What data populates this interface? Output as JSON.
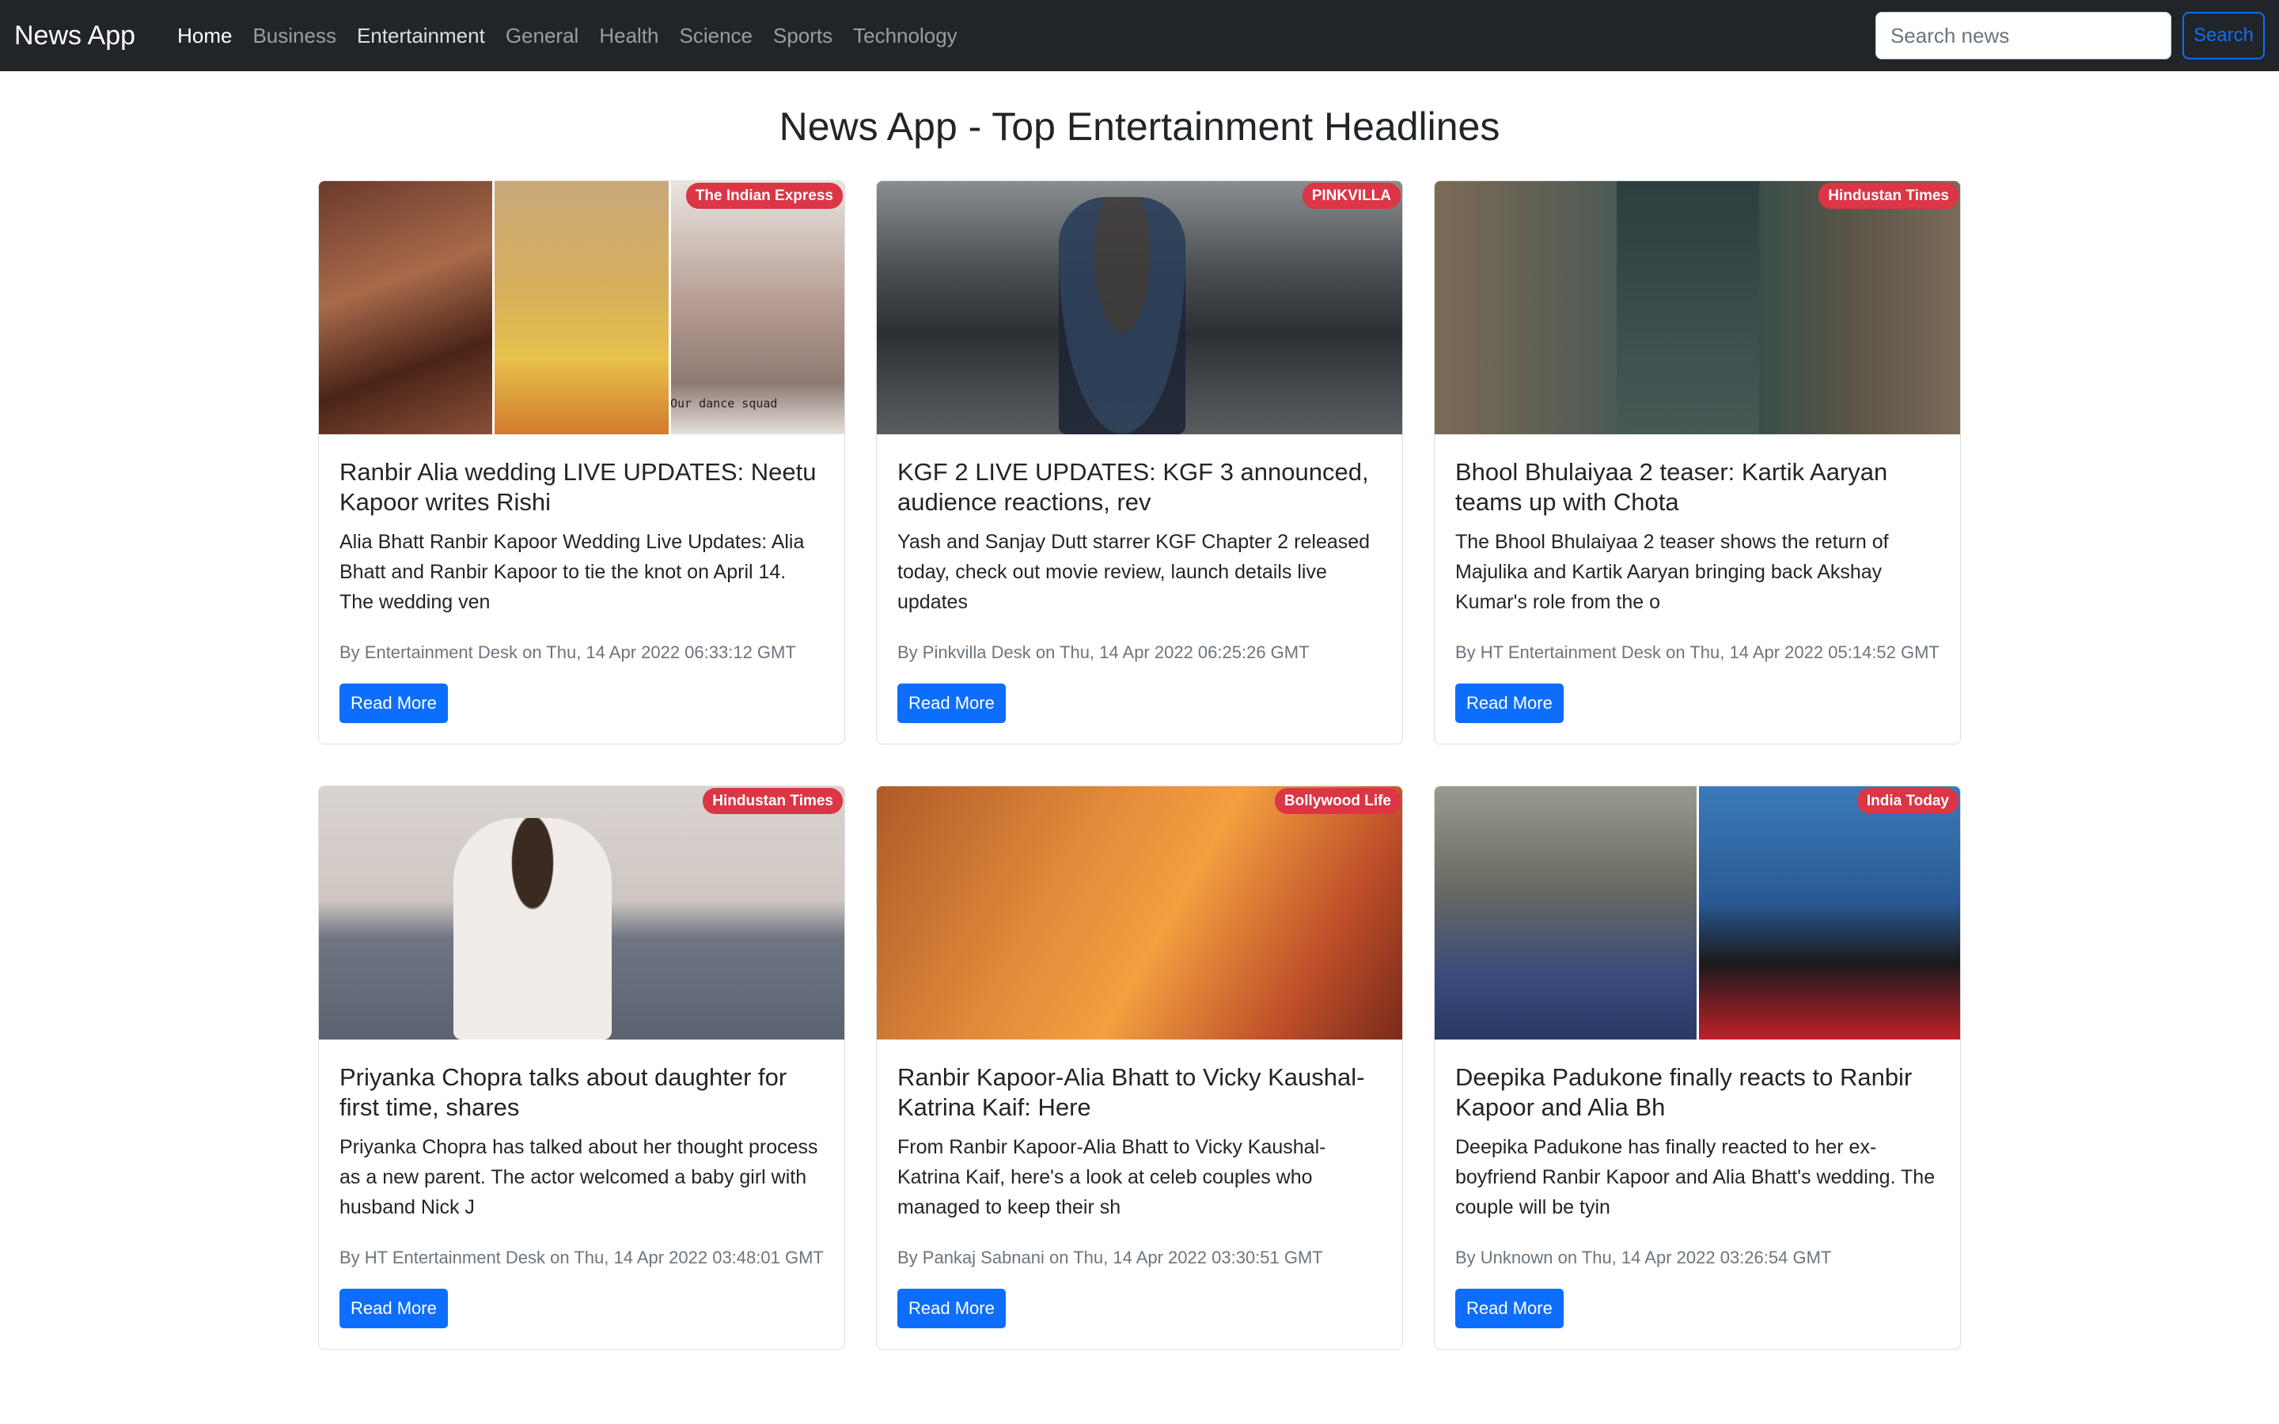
{
  "navbar": {
    "brand": "News App",
    "links": [
      {
        "label": "Home"
      },
      {
        "label": "Business"
      },
      {
        "label": "Entertainment"
      },
      {
        "label": "General"
      },
      {
        "label": "Health"
      },
      {
        "label": "Science"
      },
      {
        "label": "Sports"
      },
      {
        "label": "Technology"
      }
    ],
    "search_placeholder": "Search news",
    "search_button": "Search"
  },
  "page_title": "News App - Top Entertainment Headlines",
  "read_more_label": "Read More",
  "articles": [
    {
      "source": "The Indian Express",
      "title": "Ranbir Alia wedding LIVE UPDATES: Neetu Kapoor writes Rishi",
      "description": "Alia Bhatt Ranbir Kapoor Wedding Live Updates: Alia Bhatt and Ranbir Kapoor to tie the knot on April 14. The wedding ven",
      "meta": "By Entertainment Desk on Thu, 14 Apr 2022 06:33:12 GMT",
      "image_overlay_text": "Our dance squad"
    },
    {
      "source": "PINKVILLA",
      "title": "KGF 2 LIVE UPDATES: KGF 3 announced, audience reactions, rev",
      "description": "Yash and Sanjay Dutt starrer KGF Chapter 2 released today, check out movie review, launch details live updates",
      "meta": "By Pinkvilla Desk on Thu, 14 Apr 2022 06:25:26 GMT"
    },
    {
      "source": "Hindustan Times",
      "title": "Bhool Bhulaiyaa 2 teaser: Kartik Aaryan teams up with Chota",
      "description": "The Bhool Bhulaiyaa 2 teaser shows the return of Majulika and Kartik Aaryan bringing back Akshay Kumar's role from the o",
      "meta": "By HT Entertainment Desk on Thu, 14 Apr 2022 05:14:52 GMT"
    },
    {
      "source": "Hindustan Times",
      "title": "Priyanka Chopra talks about daughter for first time, shares",
      "description": "Priyanka Chopra has talked about her thought process as a new parent. The actor welcomed a baby girl with husband Nick J",
      "meta": "By HT Entertainment Desk on Thu, 14 Apr 2022 03:48:01 GMT"
    },
    {
      "source": "Bollywood Life",
      "title": "Ranbir Kapoor-Alia Bhatt to Vicky Kaushal-Katrina Kaif: Here",
      "description": "From Ranbir Kapoor-Alia Bhatt to Vicky Kaushal-Katrina Kaif, here's a look at celeb couples who managed to keep their sh",
      "meta": "By Pankaj Sabnani on Thu, 14 Apr 2022 03:30:51 GMT"
    },
    {
      "source": "India Today",
      "title": "Deepika Padukone finally reacts to Ranbir Kapoor and Alia Bh",
      "description": "Deepika Padukone has finally reacted to her ex-boyfriend Ranbir Kapoor and Alia Bhatt's wedding. The couple will be tyin",
      "meta": "By Unknown on Thu, 14 Apr 2022 03:26:54 GMT"
    }
  ]
}
